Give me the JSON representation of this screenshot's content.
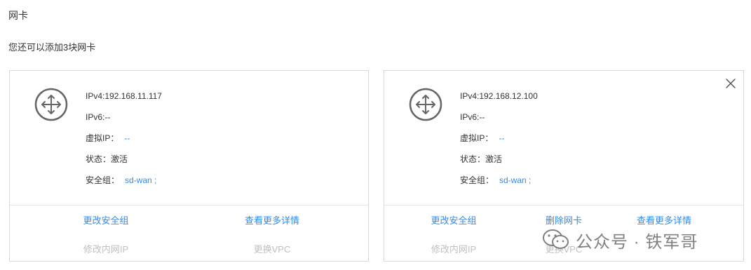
{
  "section_title": "网卡",
  "quota_text": "您还可以添加3块网卡",
  "cards": [
    {
      "ipv4": "IPv4:192.168.11.117",
      "ipv6": "IPv6:--",
      "virtual_ip_label": "虚拟IP：",
      "virtual_ip_value": "--",
      "status": "状态：激活",
      "security_group_label": "安全组：",
      "security_group_value": "sd-wan ;",
      "actions": {
        "change_security_group": "更改安全组",
        "view_details": "查看更多详情",
        "modify_private_ip": "修改内网IP",
        "replace_vpc": "更换VPC"
      }
    },
    {
      "ipv4": "IPv4:192.168.12.100",
      "ipv6": "IPv6:--",
      "virtual_ip_label": "虚拟IP：",
      "virtual_ip_value": "--",
      "status": "状态：激活",
      "security_group_label": "安全组：",
      "security_group_value": "sd-wan ;",
      "actions": {
        "change_security_group": "更改安全组",
        "delete_nic": "删除网卡",
        "view_details": "查看更多详情",
        "modify_private_ip": "修改内网IP",
        "replace_vpc": "更换VPC"
      }
    }
  ],
  "watermark": "公众号 · 铁军哥",
  "icons": {
    "nic": "network-interface-icon",
    "close": "close-icon",
    "wechat": "wechat-icon"
  },
  "colors": {
    "link": "#2d8cf0",
    "disabled": "#bfbfbf",
    "text": "#333333",
    "border": "#d9d9d9"
  }
}
